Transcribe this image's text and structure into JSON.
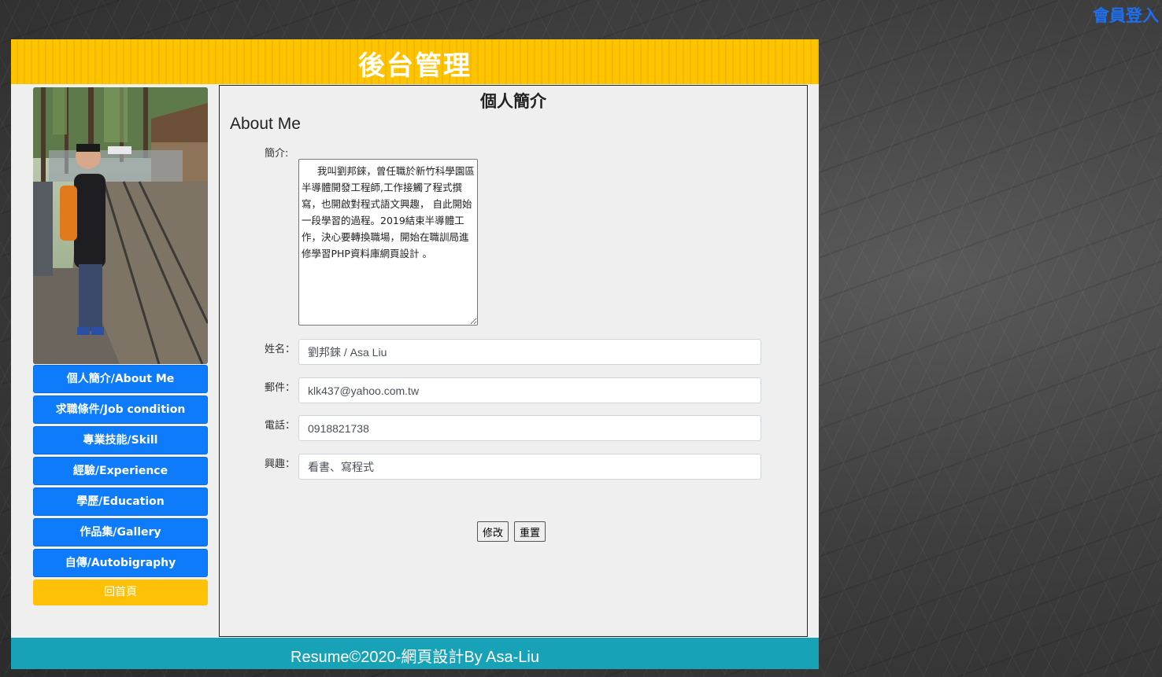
{
  "top_link": "會員登入",
  "header": {
    "title": "後台管理"
  },
  "sidebar": {
    "nav": [
      "個人簡介/About Me",
      "求職條件/Job condition",
      "專業技能/Skill",
      "經驗/Experience",
      "學歷/Education",
      "作品集/Gallery",
      "自傳/Autobigraphy"
    ],
    "home": "回首頁"
  },
  "main": {
    "title": "個人簡介",
    "subtitle": "About Me",
    "form": {
      "intro_label": "簡介:",
      "intro_value": "     我叫劉邦錸，曾任職於新竹科學園區半導體開發工程師,工作接觸了程式撰寫，也開啟對程式語文興趣， 自此開始一段學習的過程。2019結束半導體工作，決心要轉換職場，開始在職訓局進修學習PHP資料庫網頁設計 。",
      "name_label": "姓名：",
      "name_value": "劉邦錸 / Asa Liu",
      "email_label": "郵件：",
      "email_value": "klk437@yahoo.com.tw",
      "phone_label": "電話：",
      "phone_value": "0918821738",
      "hobby_label": "興趣：",
      "hobby_value": "看書、寫程式",
      "submit_label": "修改",
      "reset_label": "重置"
    }
  },
  "footer": {
    "text": "Resume©2020-網頁設計By Asa-Liu"
  },
  "colors": {
    "header_yellow": "#ffc400",
    "nav_blue": "#0d7bfa",
    "home_yellow": "#ffc107",
    "footer_teal": "#17a2b8",
    "link_blue": "#1e6ff0"
  }
}
